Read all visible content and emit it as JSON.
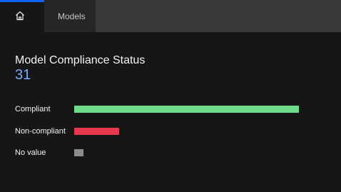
{
  "tabs": {
    "home_icon": "home-icon",
    "models_label": "Models"
  },
  "card": {
    "title": "Model Compliance Status",
    "count": "31"
  },
  "chart_data": {
    "type": "bar",
    "orientation": "horizontal",
    "categories": [
      "Compliant",
      "Non-compliant",
      "No value"
    ],
    "values": [
      25,
      5,
      1
    ],
    "colors": [
      "#6fdc8c",
      "#e8384f",
      "#8d8d8d"
    ],
    "title": "",
    "xlabel": "",
    "ylabel": "",
    "xlim": [
      0,
      25
    ]
  },
  "colors": {
    "accent": "#0f62fe",
    "count": "#78a9ff"
  }
}
